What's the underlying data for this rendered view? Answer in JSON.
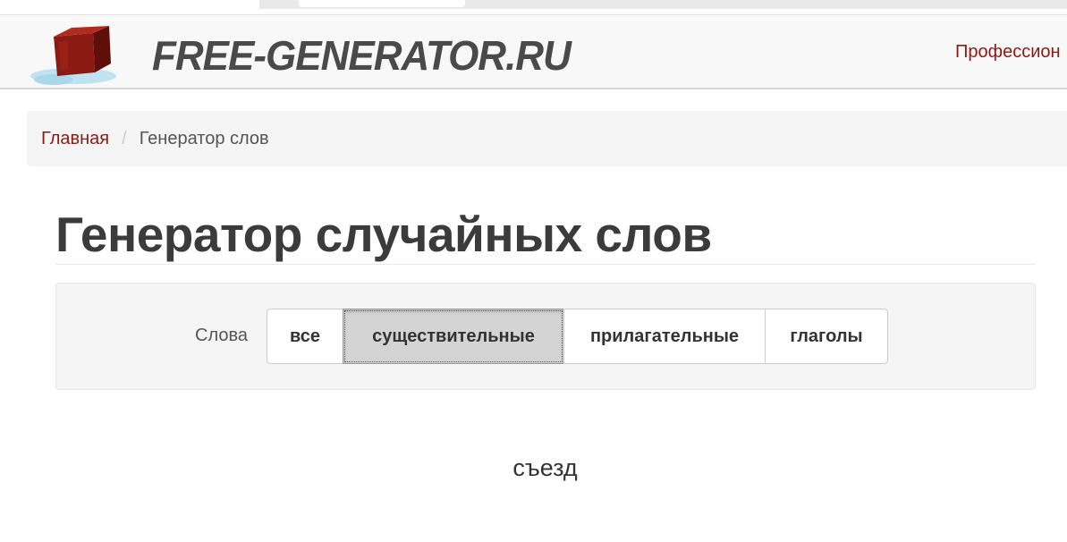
{
  "header": {
    "logo_text": "FREE-GENERATOR.RU",
    "nav_link": "Профессион"
  },
  "breadcrumb": {
    "home": "Главная",
    "separator": "/",
    "current": "Генератор слов"
  },
  "page": {
    "title": "Генератор случайных слов"
  },
  "filter": {
    "label": "Слова",
    "buttons": [
      {
        "label": "все",
        "active": false
      },
      {
        "label": "существительные",
        "active": true
      },
      {
        "label": "прилагательные",
        "active": false
      },
      {
        "label": "глаголы",
        "active": false
      }
    ]
  },
  "result": {
    "word": "съезд"
  },
  "colors": {
    "brand_red": "#8b1a12",
    "logo_text": "#4a4a4a",
    "active_button": "#d4d4d4"
  }
}
